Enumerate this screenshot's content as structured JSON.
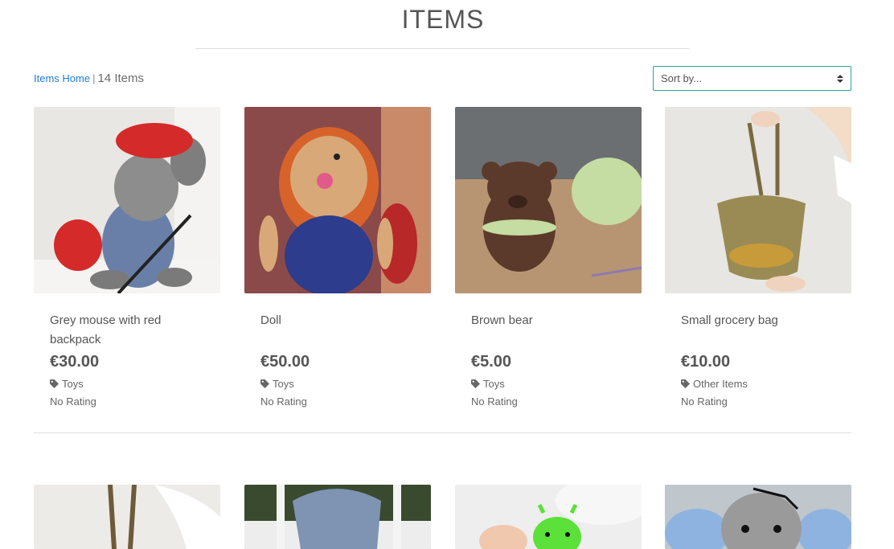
{
  "page": {
    "title": "ITEMS"
  },
  "toolbar": {
    "home_link": "Items Home",
    "separator": "|",
    "count": "14 Items",
    "sort_placeholder": "Sort by..."
  },
  "products": [
    {
      "name": "Grey mouse with red backpack",
      "price": "€30.00",
      "category": "Toys",
      "rating": "No Rating",
      "image": "crocheted grey mouse with red beret and backpack"
    },
    {
      "name": "Doll",
      "price": "€50.00",
      "category": "Toys",
      "rating": "No Rating",
      "image": "crocheted doll with orange hair and blue dress"
    },
    {
      "name": "Brown bear",
      "price": "€5.00",
      "category": "Toys",
      "rating": "No Rating",
      "image": "crocheted brown bear with green scarf"
    },
    {
      "name": "Small grocery bag",
      "price": "€10.00",
      "category": "Other Items",
      "rating": "No Rating",
      "image": "crocheted mesh grocery bag"
    }
  ],
  "colors": {
    "accent": "#2aa198",
    "link": "#1e7dd7",
    "text": "#555555"
  }
}
